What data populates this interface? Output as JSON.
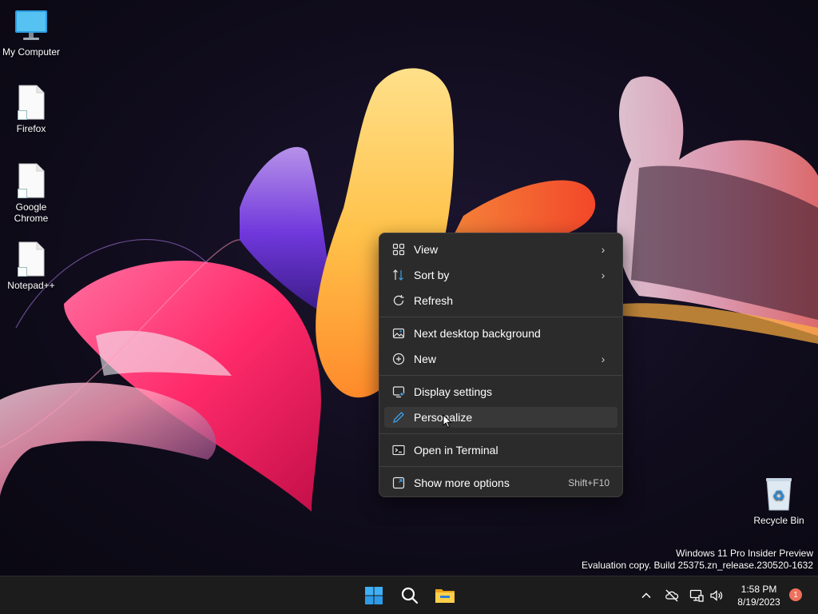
{
  "desktop": {
    "icons": [
      {
        "label": "My Computer"
      },
      {
        "label": "Firefox"
      },
      {
        "label": "Google Chrome"
      },
      {
        "label": "Notepad++"
      },
      {
        "label": "Recycle Bin"
      }
    ]
  },
  "context_menu": {
    "items": [
      {
        "label": "View",
        "icon": "grid-view-icon",
        "submenu": true
      },
      {
        "label": "Sort by",
        "icon": "sort-arrows-icon",
        "submenu": true
      },
      {
        "label": "Refresh",
        "icon": "refresh-icon"
      },
      {
        "label": "Next desktop background",
        "icon": "image-icon"
      },
      {
        "label": "New",
        "icon": "plus-circle-icon",
        "submenu": true
      },
      {
        "label": "Display settings",
        "icon": "display-settings-icon"
      },
      {
        "label": "Personalize",
        "icon": "pencil-icon",
        "hovered": true
      },
      {
        "label": "Open in Terminal",
        "icon": "terminal-icon"
      },
      {
        "label": "Show more options",
        "icon": "expand-icon",
        "shortcut": "Shift+F10"
      }
    ]
  },
  "watermark": {
    "line1": "Windows 11 Pro Insider Preview",
    "line2": "Evaluation copy. Build 25375.zn_release.230520-1632"
  },
  "taskbar": {
    "apps": [
      {
        "name": "start-button",
        "icon": "windows-logo-icon"
      },
      {
        "name": "search-button",
        "icon": "search-icon"
      },
      {
        "name": "file-explorer-button",
        "icon": "folder-icon"
      }
    ],
    "tray": {
      "icons": [
        "chevron-up-icon",
        "network-offline-icon",
        "display-icon",
        "volume-icon"
      ],
      "time": "1:58 PM",
      "date": "8/19/2023",
      "notification_count": "1"
    }
  },
  "colors": {
    "menu_bg": "#2b2b2b",
    "menu_hover": "#383838",
    "taskbar_bg": "#1c1c1c",
    "badge": "#f0705c",
    "accent_blue": "#3aa0e8"
  }
}
